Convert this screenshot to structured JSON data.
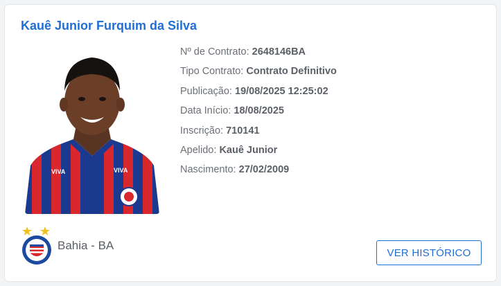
{
  "player": {
    "name": "Kauê Junior Furquim da Silva",
    "photo_icon": "player-photo"
  },
  "details": [
    {
      "label": "Nº de Contrato: ",
      "value": "2648146BA"
    },
    {
      "label": "Tipo Contrato: ",
      "value": "Contrato Definitivo"
    },
    {
      "label": "Publicação: ",
      "value": "19/08/2025 12:25:02"
    },
    {
      "label": "Data Início: ",
      "value": "18/08/2025"
    },
    {
      "label": "Inscrição: ",
      "value": "710141"
    },
    {
      "label": "Apelido: ",
      "value": "Kauê Junior"
    },
    {
      "label": "Nascimento: ",
      "value": "27/02/2009"
    }
  ],
  "club": {
    "name": "Bahia - BA",
    "crest_icon": "club-crest"
  },
  "actions": {
    "history_label": "VER HISTÓRICO"
  },
  "colors": {
    "accent": "#1f6fd6",
    "label_text": "#6b6f76",
    "value_text": "#5b5f66",
    "jersey_blue": "#1b3a8f",
    "jersey_red": "#d9272e"
  }
}
